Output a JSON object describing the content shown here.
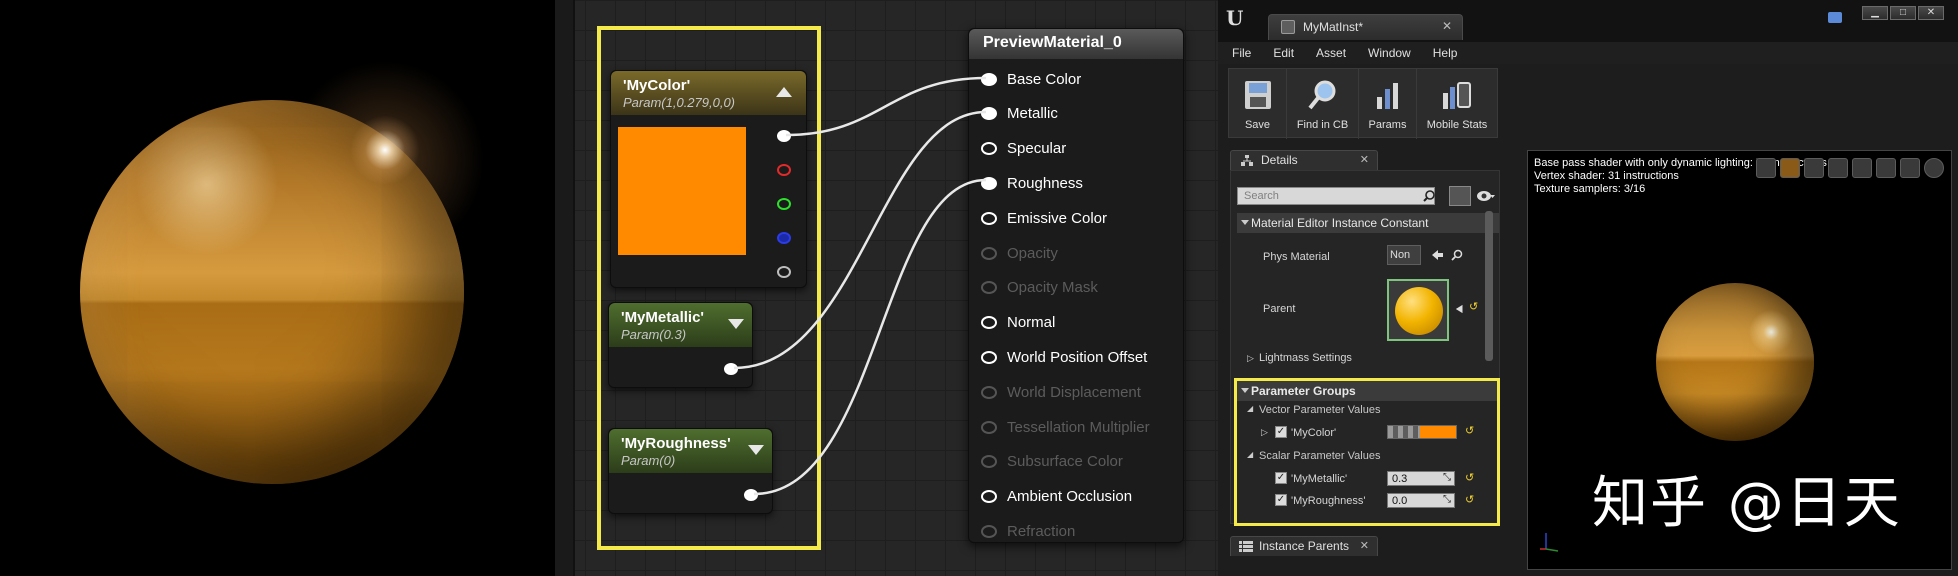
{
  "graph": {
    "preview_node": {
      "title": "PreviewMaterial_0",
      "inputs": [
        {
          "label": "Base Color",
          "enabled": true,
          "connected": true
        },
        {
          "label": "Metallic",
          "enabled": true,
          "connected": true
        },
        {
          "label": "Specular",
          "enabled": true,
          "connected": false
        },
        {
          "label": "Roughness",
          "enabled": true,
          "connected": true
        },
        {
          "label": "Emissive Color",
          "enabled": true,
          "connected": false
        },
        {
          "label": "Opacity",
          "enabled": false,
          "connected": false
        },
        {
          "label": "Opacity Mask",
          "enabled": false,
          "connected": false
        },
        {
          "label": "Normal",
          "enabled": true,
          "connected": false
        },
        {
          "label": "World Position Offset",
          "enabled": true,
          "connected": false
        },
        {
          "label": "World Displacement",
          "enabled": false,
          "connected": false
        },
        {
          "label": "Tessellation Multiplier",
          "enabled": false,
          "connected": false
        },
        {
          "label": "Subsurface Color",
          "enabled": false,
          "connected": false
        },
        {
          "label": "Ambient Occlusion",
          "enabled": true,
          "connected": false
        },
        {
          "label": "Refraction",
          "enabled": false,
          "connected": false
        }
      ]
    },
    "color_node": {
      "title": "'MyColor'",
      "subtitle": "Param(1,0.279,0,0)",
      "swatch_color": "#ff8a00",
      "header_color": "#7a6a2a"
    },
    "metallic_node": {
      "title": "'MyMetallic'",
      "subtitle": "Param(0.3)",
      "header_color": "#4f6e2e"
    },
    "roughness_node": {
      "title": "'MyRoughness'",
      "subtitle": "Param(0)",
      "header_color": "#4f6e2e"
    }
  },
  "editor": {
    "doc_tab": "MyMatInst*",
    "menu": [
      "File",
      "Edit",
      "Asset",
      "Window",
      "Help"
    ],
    "toolbar": [
      {
        "label": "Save",
        "icon": "save-icon"
      },
      {
        "label": "Find in CB",
        "icon": "find-in-cb-icon"
      },
      {
        "label": "Params",
        "icon": "params-icon"
      },
      {
        "label": "Mobile Stats",
        "icon": "mobile-stats-icon"
      }
    ],
    "details": {
      "tab": "Details",
      "search_placeholder": "Search",
      "constant_header": "Material Editor Instance Constant",
      "phys_material_label": "Phys Material",
      "phys_material_value": "Non",
      "parent_label": "Parent",
      "lightmass_label": "Lightmass Settings",
      "param_groups_header": "Parameter Groups",
      "vector_header": "Vector Parameter Values",
      "my_color_label": "'MyColor'",
      "scalar_header": "Scalar Parameter Values",
      "my_metallic_label": "'MyMetallic'",
      "my_metallic_value": "0.3",
      "my_roughness_label": "'MyRoughness'",
      "my_roughness_value": "0.0",
      "my_color_swatch": "#ff8a00"
    },
    "instance_parents_tab": "Instance Parents",
    "viewport": {
      "stats": [
        "Base pass shader with only dynamic lighting: 78 instructions",
        "Vertex shader: 31 instructions",
        "Texture samplers: 3/16"
      ]
    }
  },
  "watermark": "知乎 @日天"
}
